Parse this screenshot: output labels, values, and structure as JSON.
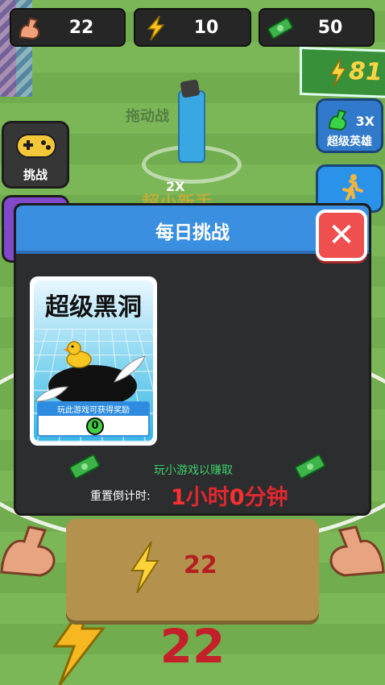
{
  "top_bar": {
    "strength": {
      "icon": "flexed-arm-icon",
      "value": "22"
    },
    "energy": {
      "icon": "lightning-icon",
      "value": "10"
    },
    "cash": {
      "icon": "cash-icon",
      "value": "50"
    }
  },
  "scene": {
    "sign_energy_value": "81",
    "hint_drag_text": "拖动战",
    "badge_2x": "2X",
    "faded_label": "超小新手"
  },
  "left_buttons": {
    "challenge_label": "挑战"
  },
  "right_buttons": {
    "super_hero_label": "超级英雄",
    "super_hero_multiplier": "3X"
  },
  "dialog": {
    "title": "每日挑战",
    "card": {
      "title": "超级黑洞",
      "reward_hint": "玩此游戏可获得奖励",
      "reward_value": "0"
    },
    "earn_text": "玩小游戏以赚取",
    "reset_label": "重置倒计时:",
    "reset_hours": "1",
    "reset_hours_unit": "小时",
    "reset_minutes": "0",
    "reset_minutes_unit": "分钟"
  },
  "bottom": {
    "panel_value": "22",
    "big_value": "22"
  },
  "colors": {
    "dialog_header": "#3a8fe0",
    "close_button": "#ef4f4f",
    "earn_text": "#3fd16a",
    "countdown": "#e0282f"
  }
}
